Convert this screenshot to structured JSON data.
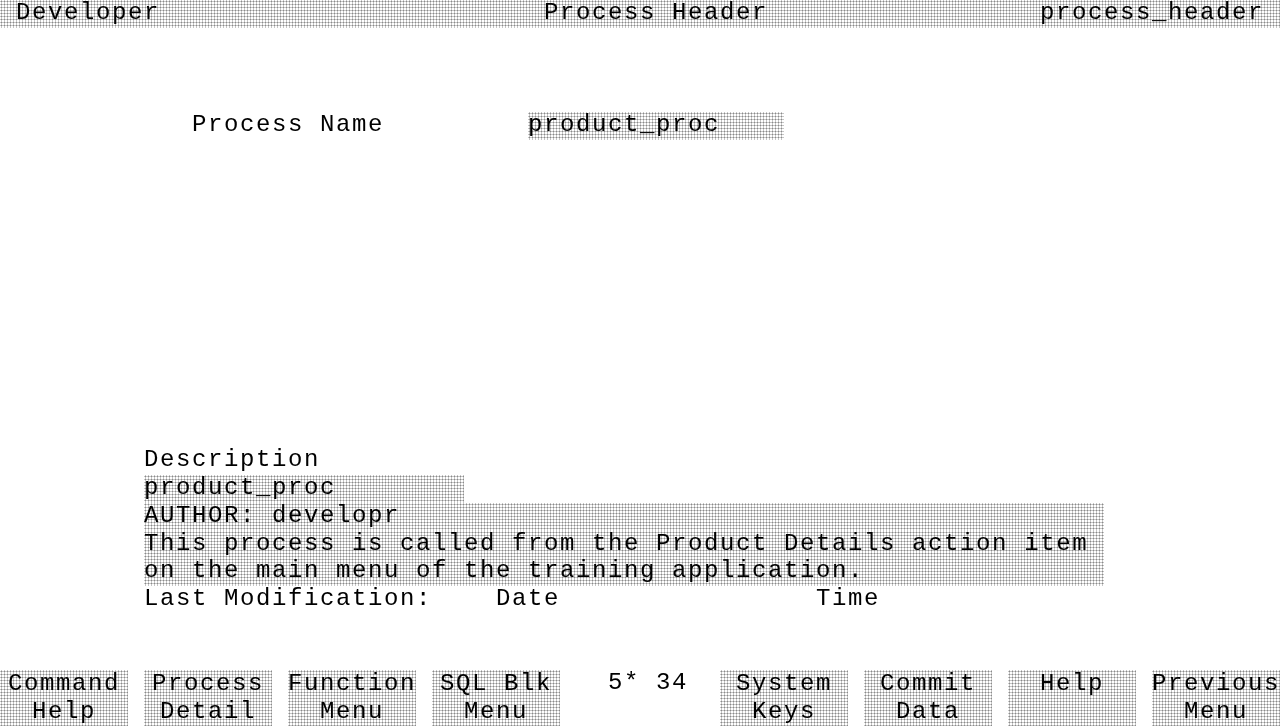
{
  "title_bar": {
    "left": "Developer",
    "center": "Process Header",
    "right": "process_header"
  },
  "process_name": {
    "label": "Process Name",
    "value": "product_proc"
  },
  "description": {
    "label": "Description",
    "lines": [
      "product_proc",
      "AUTHOR: developr",
      "This process is called from the Product Details action item",
      "on the main menu of the training application."
    ]
  },
  "last_modification": {
    "label": "Last Modification:",
    "date_label": "Date",
    "time_label": "Time"
  },
  "function_keys": [
    {
      "lines": [
        "Command",
        "Help"
      ]
    },
    {
      "lines": [
        "Process",
        "Detail"
      ]
    },
    {
      "lines": [
        "Function",
        "Menu"
      ]
    },
    {
      "lines": [
        "SQL Blk",
        "Menu"
      ]
    },
    {
      "lines": [
        "System",
        "Keys"
      ]
    },
    {
      "lines": [
        "Commit",
        "Data"
      ]
    },
    {
      "lines": [
        "Help"
      ]
    },
    {
      "lines": [
        "Previous",
        "Menu"
      ]
    }
  ],
  "status": "5* 34"
}
